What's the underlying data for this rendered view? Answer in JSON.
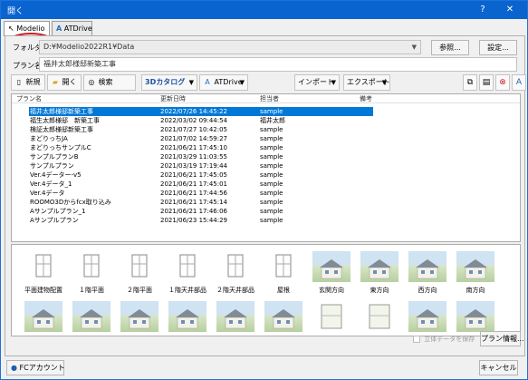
{
  "window": {
    "title": "開く",
    "help": "?",
    "close": "✕"
  },
  "tabs": [
    {
      "label": "Modelio",
      "icon": "↖"
    },
    {
      "label": "ATDrive",
      "icon": "A"
    }
  ],
  "folder": {
    "label": "フォルダ",
    "value": "D:¥Modelio2022R1¥Data"
  },
  "plan_name": {
    "label": "プラン名",
    "value": "福井太郎様邸新築工事"
  },
  "buttons": {
    "browse": "参照...",
    "settings": "設定...",
    "plan_info": "プラン情報...",
    "cancel": "キャンセル",
    "fc_account": "FCアカウント"
  },
  "toolbar": {
    "new": "新規",
    "open": "開く",
    "search": "検索",
    "catalog": "3Dカタログ",
    "atdrive": "ATDrive",
    "import": "インポート",
    "export": "エクスポート"
  },
  "list": {
    "columns": [
      "プラン名",
      "更新日時",
      "担当者",
      "備考"
    ],
    "rows": [
      [
        "福井太郎様邸新築工事",
        "2022/07/26 14:45:22",
        "sample",
        ""
      ],
      [
        "福生太郎様邸　新築工事",
        "2022/03/02 09:44:54",
        "福井太郎",
        ""
      ],
      [
        "検証太郎様邸新築工事",
        "2021/07/27 10:42:05",
        "sample",
        ""
      ],
      [
        "まどりっちJA",
        "2021/07/02 14:59:27",
        "sample",
        ""
      ],
      [
        "まどりっちサンプルC",
        "2021/06/21 17:45:10",
        "sample",
        ""
      ],
      [
        "サンプルプランB",
        "2021/03/29 11:03:55",
        "sample",
        ""
      ],
      [
        "サンプルプラン",
        "2021/03/19 17:19:44",
        "sample",
        ""
      ],
      [
        "Ver.4データー-v5",
        "2021/06/21 17:45:05",
        "sample",
        ""
      ],
      [
        "Ver.4データ_1",
        "2021/06/21 17:45:01",
        "sample",
        ""
      ],
      [
        "Ver.4データ",
        "2021/06/21 17:44:56",
        "sample",
        ""
      ],
      [
        "ROOMO3Dからfcx取り込み",
        "2021/06/21 17:45:14",
        "sample",
        ""
      ],
      [
        "Aサンプルプラン_1",
        "2021/06/21 17:46:06",
        "sample",
        ""
      ],
      [
        "Aサンプルプラン",
        "2021/06/23 15:44:29",
        "sample",
        ""
      ]
    ]
  },
  "thumbnails": [
    "平面建物配置",
    "１階平面",
    "２階平面",
    "１階天井部品",
    "２階天井部品",
    "屋根",
    "玄関方向",
    "東方向",
    "西方向",
    "南方向"
  ],
  "save3d": "立体データを保存"
}
